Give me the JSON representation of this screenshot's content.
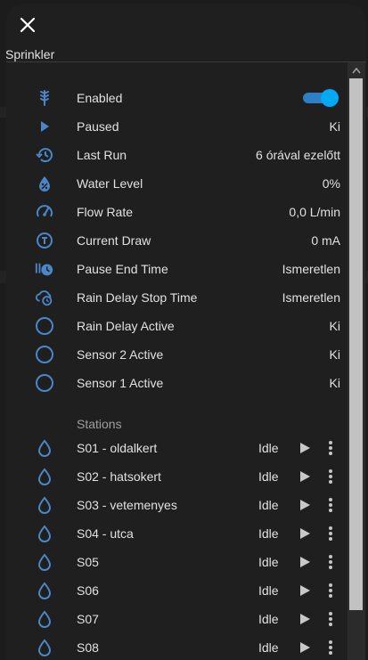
{
  "dialog": {
    "title": "Sprinkler"
  },
  "entities": [
    {
      "icon": "sprinkler-icon",
      "label": "Enabled",
      "type": "toggle",
      "value": ""
    },
    {
      "icon": "play-icon",
      "label": "Paused",
      "value": "Ki"
    },
    {
      "icon": "history-icon",
      "label": "Last Run",
      "value": "6 órával ezelőtt"
    },
    {
      "icon": "water-percent-icon",
      "label": "Water Level",
      "value": "0%"
    },
    {
      "icon": "gauge-icon",
      "label": "Flow Rate",
      "value": "0,0 L/min"
    },
    {
      "icon": "current-meter-icon",
      "label": "Current Draw",
      "value": "0 mA"
    },
    {
      "icon": "clock-pause-icon",
      "label": "Pause End Time",
      "value": "Ismeretlen"
    },
    {
      "icon": "cloud-clock-icon",
      "label": "Rain Delay Stop Time",
      "value": "Ismeretlen"
    },
    {
      "icon": "circle-outline-icon",
      "label": "Rain Delay Active",
      "value": "Ki"
    },
    {
      "icon": "circle-outline-icon",
      "label": "Sensor 2 Active",
      "value": "Ki"
    },
    {
      "icon": "circle-outline-icon",
      "label": "Sensor 1 Active",
      "value": "Ki"
    }
  ],
  "stations_section": {
    "title": "Stations"
  },
  "stations": [
    {
      "name": "S01 - oldalkert",
      "state": "Idle"
    },
    {
      "name": "S02 - hatsokert",
      "state": "Idle"
    },
    {
      "name": "S03 - vetemenyes",
      "state": "Idle"
    },
    {
      "name": "S04 - utca",
      "state": "Idle"
    },
    {
      "name": "S05",
      "state": "Idle"
    },
    {
      "name": "S06",
      "state": "Idle"
    },
    {
      "name": "S07",
      "state": "Idle"
    },
    {
      "name": "S08",
      "state": "Idle"
    }
  ],
  "colors": {
    "icon": "#4a86c8",
    "accent": "#03a9f4",
    "text": "#e1e1e1",
    "secondary_text": "#9e9e9e"
  }
}
